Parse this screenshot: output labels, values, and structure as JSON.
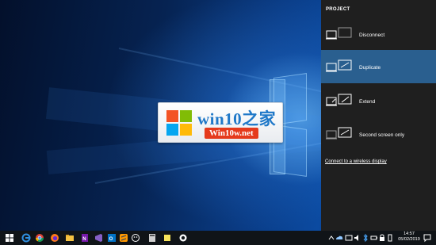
{
  "desktop": {
    "logo": {
      "title": "win10之家",
      "subtitle": "Win10w.net"
    }
  },
  "project_pane": {
    "header": "PROJECT",
    "options": [
      {
        "label": "Disconnect",
        "selected": false,
        "icon": "pc-screen-only-icon"
      },
      {
        "label": "Duplicate",
        "selected": true,
        "icon": "duplicate-icon"
      },
      {
        "label": "Extend",
        "selected": false,
        "icon": "extend-icon"
      },
      {
        "label": "Second screen only",
        "selected": false,
        "icon": "second-screen-only-icon"
      }
    ],
    "wireless_link": "Connect to a wireless display",
    "selected_color": "#2a5f8f"
  },
  "taskbar": {
    "pinned": [
      "windows-start-icon",
      "edge-icon",
      "chrome-icon",
      "firefox-icon",
      "file-explorer-icon",
      "onenote-icon",
      "visual-studio-icon",
      "outlook-icon",
      "sublime-icon",
      "snipping-icon",
      "calculator-icon",
      "sticky-notes-icon",
      "store-icon"
    ],
    "tray_icons": [
      "show-hidden-icons-chevron",
      "onedrive-icon",
      "network-icon",
      "volume-icon",
      "bluetooth-icon",
      "battery-icon",
      "lock-icon",
      "phone-icon"
    ],
    "clock": {
      "time": "14:57",
      "date": "05/02/2019"
    },
    "notifications_icon": "action-center-icon"
  }
}
